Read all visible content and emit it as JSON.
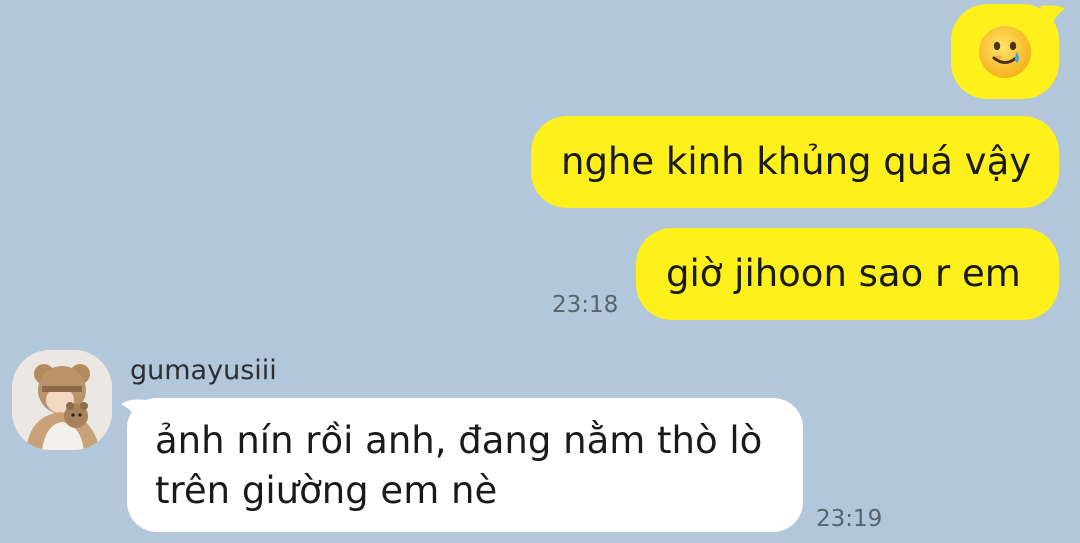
{
  "conversation": {
    "outgoing": [
      {
        "type": "emoji",
        "icon": "smiling-face-with-tear-icon"
      },
      {
        "text": "nghe kinh khủng quá vậy"
      },
      {
        "text": "giờ jihoon sao r em"
      }
    ],
    "outgoing_time": "23:18",
    "incoming": {
      "sender": "gumayusiii",
      "avatar_icon": "profile-avatar",
      "text": "ảnh nín rồi anh, đang nằm thò lò trên giường em nè",
      "time": "23:19"
    }
  },
  "colors": {
    "background": "#b2c7d9",
    "outgoing_bubble": "#fef01b",
    "incoming_bubble": "#ffffff",
    "timestamp": "#586470"
  }
}
